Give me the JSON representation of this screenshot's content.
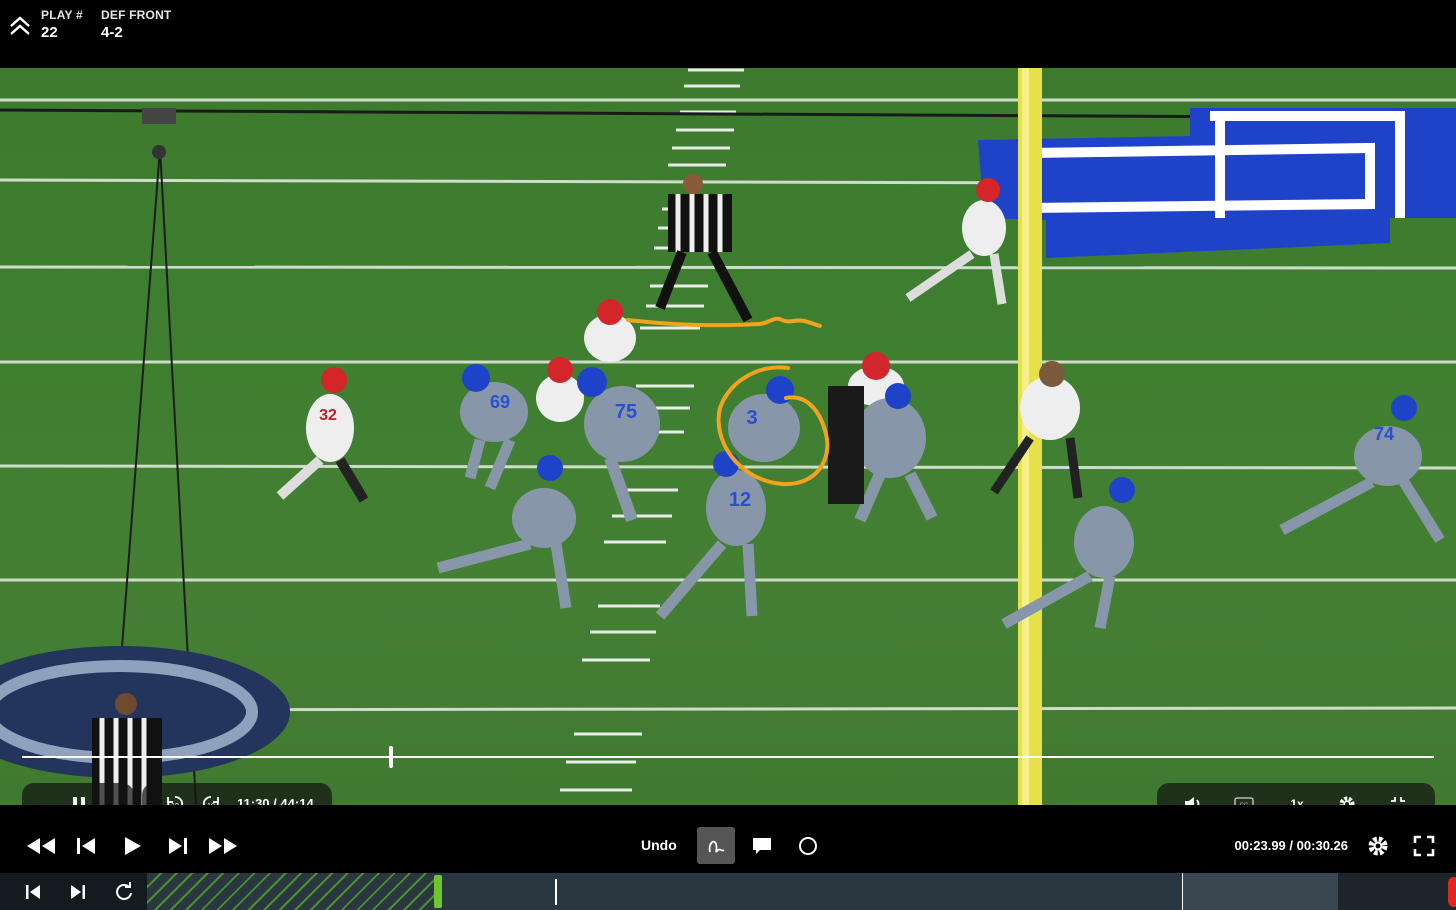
{
  "header": {
    "play_label": "PLAY #",
    "play_value": "22",
    "front_label": "DEF FRONT",
    "front_value": "4-2"
  },
  "video": {
    "progress_fraction": 0.261,
    "players": {
      "offense_numbers": [
        "69",
        "75",
        "3",
        "12",
        "74"
      ],
      "defense_numbers": [
        "32"
      ]
    },
    "annotation_color": "#f2a21b"
  },
  "player_controls": {
    "rewind_10_label": "10",
    "forward_10_label": "10",
    "time_current": "11:30",
    "time_separator": "/",
    "time_total": "44:14",
    "speed_label": "1x"
  },
  "editor_controls": {
    "undo_label": "Undo",
    "clip_time_current": "00:23.99",
    "clip_time_separator": "/",
    "clip_time_total": "00:30.26"
  },
  "colors": {
    "accent_green": "#6ec52f",
    "field_green": "#3f7f30",
    "kentucky_blue": "#1f43c8",
    "post_yellow": "#e6e04a"
  },
  "icons": [
    "collapse-up-icon",
    "pause-icon",
    "rewind-10-icon",
    "forward-10-icon",
    "volume-icon",
    "captions-icon",
    "settings-gear-icon",
    "fullscreen-icon",
    "fast-rewind-icon",
    "step-back-icon",
    "play-icon",
    "step-forward-icon",
    "fast-forward-icon",
    "draw-pen-icon",
    "comment-icon",
    "circle-shape-icon",
    "skip-start-icon",
    "skip-end-icon",
    "loop-icon"
  ]
}
